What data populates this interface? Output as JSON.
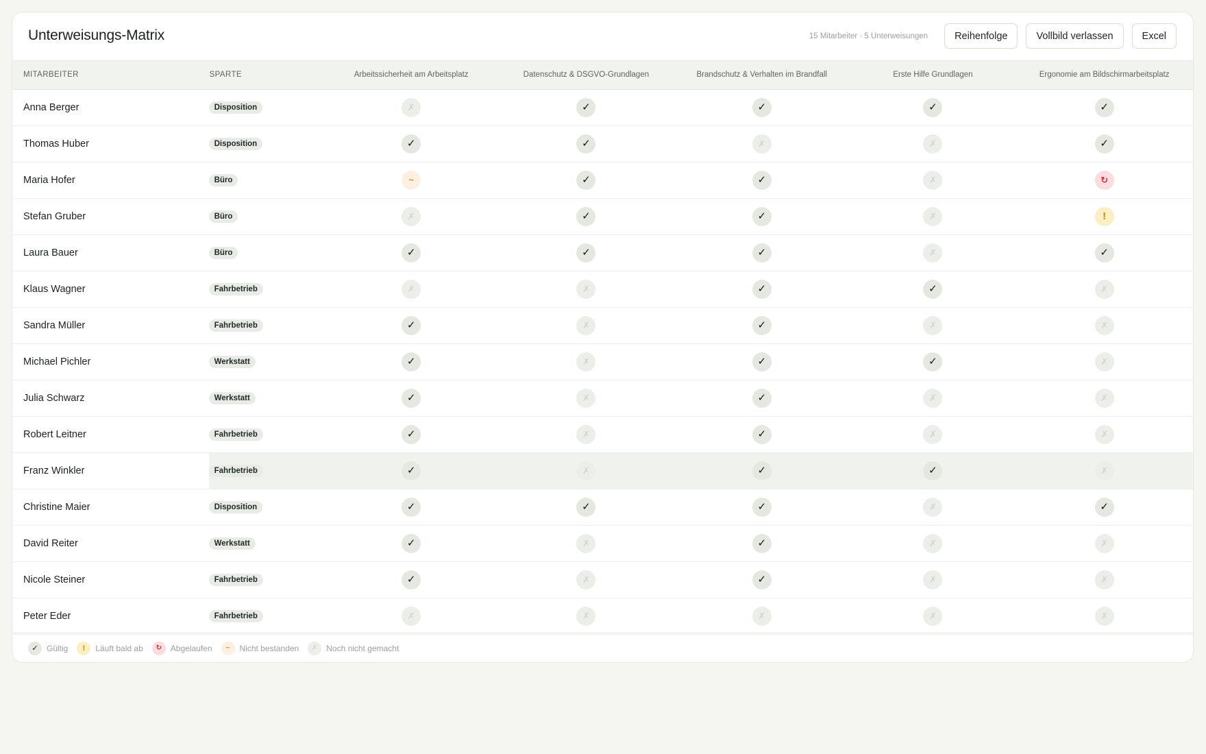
{
  "header": {
    "title": "Unterweisungs-Matrix",
    "meta": "15 Mitarbeiter · 5 Unterweisungen",
    "buttons": [
      "Reihenfolge",
      "Vollbild verlassen",
      "Excel"
    ]
  },
  "table": {
    "col_employee": "MITARBEITER",
    "col_sparte": "SPARTE",
    "trainings": [
      "Arbeitssicherheit am Arbeitsplatz",
      "Datenschutz & DSGVO-Grundlagen",
      "Brandschutz & Verhalten im Brandfall",
      "Erste Hilfe Grundlagen",
      "Ergonomie am Bildschirmarbeitsplatz"
    ],
    "highlighted_row": 10,
    "rows": [
      {
        "name": "Anna Berger",
        "sparte": "Disposition",
        "status": [
          "none",
          "valid",
          "valid",
          "valid",
          "valid"
        ]
      },
      {
        "name": "Thomas Huber",
        "sparte": "Disposition",
        "status": [
          "valid",
          "valid",
          "none",
          "none",
          "valid"
        ]
      },
      {
        "name": "Maria Hofer",
        "sparte": "Büro",
        "status": [
          "failed",
          "valid",
          "valid",
          "none",
          "expired"
        ]
      },
      {
        "name": "Stefan Gruber",
        "sparte": "Büro",
        "status": [
          "none",
          "valid",
          "valid",
          "none",
          "soon"
        ]
      },
      {
        "name": "Laura Bauer",
        "sparte": "Büro",
        "status": [
          "valid",
          "valid",
          "valid",
          "none",
          "valid"
        ]
      },
      {
        "name": "Klaus Wagner",
        "sparte": "Fahrbetrieb",
        "status": [
          "none",
          "none",
          "valid",
          "valid",
          "none"
        ]
      },
      {
        "name": "Sandra Müller",
        "sparte": "Fahrbetrieb",
        "status": [
          "valid",
          "none",
          "valid",
          "none",
          "none"
        ]
      },
      {
        "name": "Michael Pichler",
        "sparte": "Werkstatt",
        "status": [
          "valid",
          "none",
          "valid",
          "valid",
          "none"
        ]
      },
      {
        "name": "Julia Schwarz",
        "sparte": "Werkstatt",
        "status": [
          "valid",
          "none",
          "valid",
          "none",
          "none"
        ]
      },
      {
        "name": "Robert Leitner",
        "sparte": "Fahrbetrieb",
        "status": [
          "valid",
          "none",
          "valid",
          "none",
          "none"
        ]
      },
      {
        "name": "Franz Winkler",
        "sparte": "Fahrbetrieb",
        "status": [
          "valid",
          "none",
          "valid",
          "valid",
          "none"
        ]
      },
      {
        "name": "Christine Maier",
        "sparte": "Disposition",
        "status": [
          "valid",
          "valid",
          "valid",
          "none",
          "valid"
        ]
      },
      {
        "name": "David Reiter",
        "sparte": "Werkstatt",
        "status": [
          "valid",
          "none",
          "valid",
          "none",
          "none"
        ]
      },
      {
        "name": "Nicole Steiner",
        "sparte": "Fahrbetrieb",
        "status": [
          "valid",
          "none",
          "valid",
          "none",
          "none"
        ]
      },
      {
        "name": "Peter Eder",
        "sparte": "Fahrbetrieb",
        "status": [
          "none",
          "none",
          "none",
          "none",
          "none"
        ]
      }
    ]
  },
  "status_icons": {
    "valid": {
      "glyph": "✓",
      "icon": "check-icon"
    },
    "soon": {
      "glyph": "!",
      "icon": "warning-icon"
    },
    "expired": {
      "glyph": "↻",
      "icon": "expired-icon"
    },
    "failed": {
      "glyph": "~",
      "icon": "failed-icon"
    },
    "none": {
      "glyph": "✗",
      "icon": "not-done-icon"
    }
  },
  "legend": [
    {
      "status": "valid",
      "label": "Gültig"
    },
    {
      "status": "soon",
      "label": "Läuft bald ab"
    },
    {
      "status": "expired",
      "label": "Abgelaufen"
    },
    {
      "status": "failed",
      "label": "Nicht bestanden"
    },
    {
      "status": "none",
      "label": "Noch nicht gemacht"
    }
  ],
  "colors": {
    "background": "#f5f6f2",
    "valid_bg": "#e4e8e1",
    "soon_bg": "#fcefc4",
    "expired_bg": "#fbdde0",
    "failed_bg": "#fdf0e2"
  }
}
